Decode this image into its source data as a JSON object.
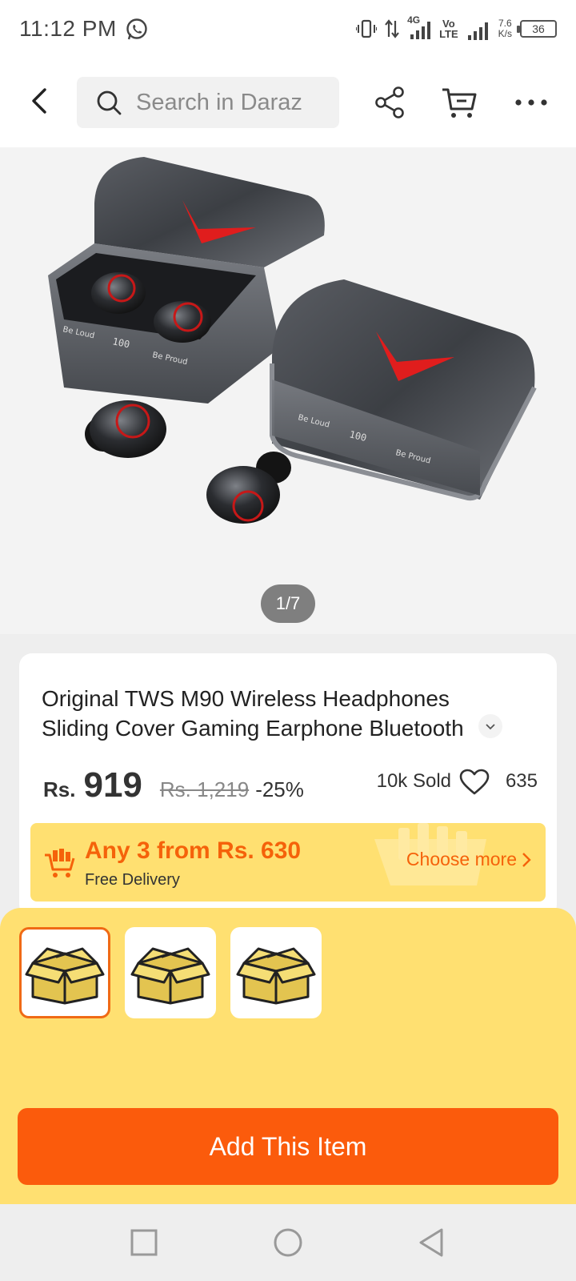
{
  "status_bar": {
    "time": "11:12 PM",
    "network_4g": "4G",
    "volte": "Vo\nLTE",
    "speed_value": "7.6",
    "speed_unit": "K/s",
    "battery": "36",
    "icons": [
      "whatsapp-icon",
      "vibrate-icon",
      "data-arrows-icon",
      "signal-icon",
      "signal-icon",
      "battery-icon"
    ]
  },
  "header": {
    "search_placeholder": "Search in Daraz",
    "icons": [
      "back-icon",
      "search-icon",
      "share-icon",
      "cart-icon",
      "more-icon"
    ]
  },
  "gallery": {
    "page_indicator": "1/7"
  },
  "product": {
    "title_line1": "Original TWS M90 Wireless Headphones",
    "title_line2": "Sliding Cover Gaming Earphone Bluetooth",
    "currency": "Rs.",
    "price": "919",
    "original_price": "Rs. 1,219",
    "discount": "-25%",
    "sold": "10k Sold",
    "likes": "635"
  },
  "promo": {
    "title": "Any 3 from Rs. 630",
    "subtitle": "Free Delivery",
    "link": "Choose more"
  },
  "sheet": {
    "variants": 3,
    "selected_variant": 0,
    "add_button": "Add This Item"
  },
  "colors": {
    "accent": "#fb5b0c",
    "promo_bg": "#ffe071",
    "promo_text": "#f5620a"
  },
  "navbar": {
    "icons": [
      "recents-icon",
      "home-icon",
      "back-nav-icon"
    ]
  }
}
